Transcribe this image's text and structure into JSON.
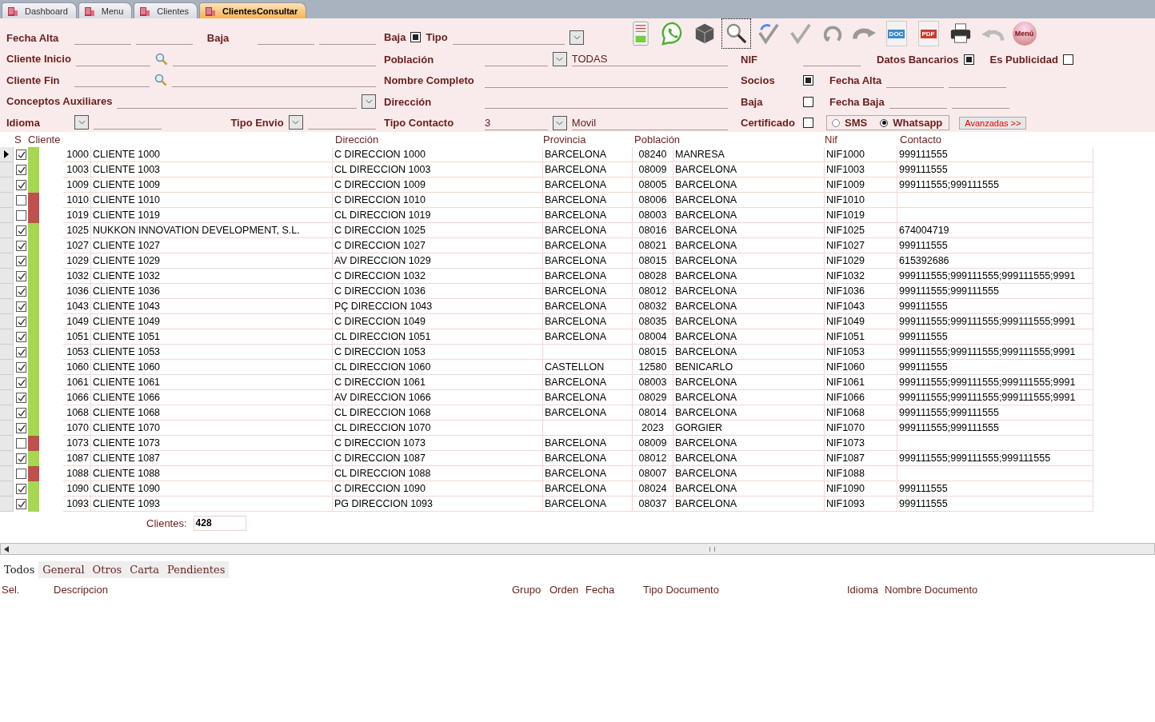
{
  "tabs": [
    {
      "label": "Dashboard",
      "selected": false
    },
    {
      "label": "Menu",
      "selected": false
    },
    {
      "label": "Clientes",
      "selected": false
    },
    {
      "label": "ClientesConsultar",
      "selected": true
    }
  ],
  "filters": {
    "left": [
      [
        {
          "kind": "label",
          "text": "Fecha Alta"
        },
        {
          "kind": "field"
        },
        {
          "kind": "field"
        },
        {
          "kind": "label",
          "text": "Baja"
        },
        {
          "kind": "field"
        },
        {
          "kind": "field"
        }
      ],
      [
        {
          "kind": "label",
          "text": "Cliente Inicio"
        },
        {
          "kind": "field"
        },
        {
          "kind": "search"
        },
        {
          "kind": "longfield"
        }
      ],
      [
        {
          "kind": "label",
          "text": "Cliente Fin"
        },
        {
          "kind": "field"
        },
        {
          "kind": "search"
        },
        {
          "kind": "longfield"
        }
      ],
      [
        {
          "kind": "label",
          "text": "Conceptos Auxiliares"
        },
        {
          "kind": "longfield"
        },
        {
          "kind": "dropdown"
        }
      ],
      [
        {
          "kind": "label",
          "text": "Idioma"
        },
        {
          "kind": "dropdown"
        },
        {
          "kind": "field"
        },
        {
          "kind": "label",
          "text": "Tipo Envio"
        },
        {
          "kind": "dropdown"
        },
        {
          "kind": "field"
        }
      ]
    ],
    "top": [
      {
        "kind": "label",
        "text": "Baja"
      },
      {
        "kind": "checkbox",
        "checked": true
      },
      {
        "kind": "label",
        "text": "Tipo"
      },
      {
        "kind": "longfield"
      },
      {
        "kind": "dropdown"
      }
    ],
    "middle": [
      [
        {
          "kind": "label",
          "text": "Población"
        },
        {
          "kind": "field"
        },
        {
          "kind": "dropdown"
        },
        {
          "kind": "longfield",
          "value": "TODAS"
        }
      ],
      [
        {
          "kind": "label",
          "text": "Nombre Completo"
        },
        {
          "kind": "longfield"
        }
      ],
      [
        {
          "kind": "label",
          "text": "Dirección"
        },
        {
          "kind": "longfield"
        }
      ],
      [
        {
          "kind": "label",
          "text": "Tipo Contacto"
        },
        {
          "kind": "field",
          "value": "3"
        },
        {
          "kind": "dropdown"
        },
        {
          "kind": "longfield",
          "value": "Movil"
        }
      ]
    ],
    "right": [
      [
        {
          "kind": "label",
          "text": "NIF"
        },
        {
          "kind": "field"
        },
        {
          "kind": "label",
          "text": "Datos Bancarios"
        },
        {
          "kind": "checkbox",
          "checked": true
        },
        {
          "kind": "label",
          "text": "Es Publicidad"
        },
        {
          "kind": "checkbox",
          "checked": false
        }
      ],
      [
        {
          "kind": "label",
          "text": "Socios"
        },
        {
          "kind": "checkbox",
          "checked": true
        },
        {
          "kind": "label",
          "text": "Fecha Alta"
        },
        {
          "kind": "field"
        },
        {
          "kind": "field"
        }
      ],
      [
        {
          "kind": "label",
          "text": "Baja"
        },
        {
          "kind": "checkbox",
          "checked": false
        },
        {
          "kind": "label",
          "text": "Fecha Baja"
        },
        {
          "kind": "field"
        },
        {
          "kind": "field"
        }
      ],
      [
        {
          "kind": "label",
          "text": "Certificado"
        },
        {
          "kind": "checkbox",
          "checked": false
        },
        {
          "kind": "radios",
          "options": [
            {
              "label": "SMS",
              "selected": false
            },
            {
              "label": "Whatsapp",
              "selected": true
            }
          ]
        },
        {
          "kind": "button",
          "label": "Avanzadas >>"
        }
      ]
    ]
  },
  "toolbar": [
    {
      "kind": "document",
      "focused": false
    },
    {
      "kind": "chat",
      "focused": false
    },
    {
      "kind": "cube",
      "focused": false
    },
    {
      "kind": "search",
      "focused": true
    },
    {
      "kind": "check-refresh",
      "focused": false
    },
    {
      "kind": "check",
      "focused": false
    },
    {
      "kind": "refresh",
      "focused": false
    },
    {
      "kind": "redo",
      "focused": false
    },
    {
      "kind": "doc",
      "label": "DOC",
      "focused": false
    },
    {
      "kind": "pdf",
      "label": "PDF",
      "focused": false
    },
    {
      "kind": "print",
      "focused": false
    },
    {
      "kind": "undo",
      "focused": false
    },
    {
      "kind": "menu",
      "label": "Menú",
      "focused": false
    }
  ],
  "table": {
    "columns": [
      "S",
      "Cliente",
      "Dirección",
      "Provincia",
      "Población",
      "Nif",
      "Contacto"
    ],
    "rows": [
      {
        "current": true,
        "checked": true,
        "color": "#a5d74f",
        "code": "1000",
        "name": "CLIENTE 1000",
        "address": "C DIRECCION 1000",
        "province": "BARCELONA",
        "zip": "08240",
        "town": "MANRESA",
        "nif": "NIF1000",
        "contact": "999111555"
      },
      {
        "current": false,
        "checked": true,
        "color": "#a5d74f",
        "code": "1003",
        "name": "CLIENTE 1003",
        "address": "CL DIRECCION 1003",
        "province": "BARCELONA",
        "zip": "08009",
        "town": "BARCELONA",
        "nif": "NIF1003",
        "contact": "999111555"
      },
      {
        "current": false,
        "checked": true,
        "color": "#a5d74f",
        "code": "1009",
        "name": "CLIENTE 1009",
        "address": "C DIRECCION 1009",
        "province": "BARCELONA",
        "zip": "08005",
        "town": "BARCELONA",
        "nif": "NIF1009",
        "contact": "999111555;999111555"
      },
      {
        "current": false,
        "checked": false,
        "color": "#c0504d",
        "code": "1010",
        "name": "CLIENTE 1010",
        "address": "C DIRECCION 1010",
        "province": "BARCELONA",
        "zip": "08006",
        "town": "BARCELONA",
        "nif": "NIF1010"
      },
      {
        "current": false,
        "checked": false,
        "color": "#c0504d",
        "code": "1019",
        "name": "CLIENTE 1019",
        "address": "CL DIRECCION 1019",
        "province": "BARCELONA",
        "zip": "08003",
        "town": "BARCELONA",
        "nif": "NIF1019"
      },
      {
        "current": false,
        "checked": true,
        "color": "#a5d74f",
        "code": "1025",
        "name": "NUKKON INNOVATION DEVELOPMENT, S.L.",
        "address": "C DIRECCION 1025",
        "province": "BARCELONA",
        "zip": "08016",
        "town": "BARCELONA",
        "nif": "NIF1025",
        "contact": "674004719"
      },
      {
        "current": false,
        "checked": true,
        "color": "#a5d74f",
        "code": "1027",
        "name": "CLIENTE 1027",
        "address": "C DIRECCION 1027",
        "province": "BARCELONA",
        "zip": "08021",
        "town": "BARCELONA",
        "nif": "NIF1027",
        "contact": "999111555"
      },
      {
        "current": false,
        "checked": true,
        "color": "#a5d74f",
        "code": "1029",
        "name": "CLIENTE 1029",
        "address": "AV DIRECCION 1029",
        "province": "BARCELONA",
        "zip": "08015",
        "town": "BARCELONA",
        "nif": "NIF1029",
        "contact": "615392686"
      },
      {
        "current": false,
        "checked": true,
        "color": "#a5d74f",
        "code": "1032",
        "name": "CLIENTE 1032",
        "address": "C DIRECCION 1032",
        "province": "BARCELONA",
        "zip": "08028",
        "town": "BARCELONA",
        "nif": "NIF1032",
        "contact": "999111555;999111555;999111555;9991"
      },
      {
        "current": false,
        "checked": true,
        "color": "#a5d74f",
        "code": "1036",
        "name": "CLIENTE 1036",
        "address": "C DIRECCION 1036",
        "province": "BARCELONA",
        "zip": "08012",
        "town": "BARCELONA",
        "nif": "NIF1036",
        "contact": "999111555;999111555"
      },
      {
        "current": false,
        "checked": true,
        "color": "#a5d74f",
        "code": "1043",
        "name": "CLIENTE 1043",
        "address": "PÇ DIRECCION 1043",
        "province": "BARCELONA",
        "zip": "08032",
        "town": "BARCELONA",
        "nif": "NIF1043",
        "contact": "999111555"
      },
      {
        "current": false,
        "checked": true,
        "color": "#a5d74f",
        "code": "1049",
        "name": "CLIENTE 1049",
        "address": "C DIRECCION 1049",
        "province": "BARCELONA",
        "zip": "08035",
        "town": "BARCELONA",
        "nif": "NIF1049",
        "contact": "999111555;999111555;999111555;9991"
      },
      {
        "current": false,
        "checked": true,
        "color": "#a5d74f",
        "code": "1051",
        "name": "CLIENTE 1051",
        "address": "CL DIRECCION 1051",
        "province": "BARCELONA",
        "zip": "08004",
        "town": "BARCELONA",
        "nif": "NIF1051",
        "contact": "999111555"
      },
      {
        "current": false,
        "checked": true,
        "color": "#a5d74f",
        "code": "1053",
        "name": "CLIENTE 1053",
        "address": "C DIRECCION 1053",
        "zip": "08015",
        "town": "BARCELONA",
        "nif": "NIF1053",
        "contact": "999111555;999111555;999111555;9991"
      },
      {
        "current": false,
        "checked": true,
        "color": "#a5d74f",
        "code": "1060",
        "name": "CLIENTE 1060",
        "address": "CL DIRECCION 1060",
        "province": "CASTELLON",
        "zip": "12580",
        "town": "BENICARLO",
        "nif": "NIF1060",
        "contact": "999111555"
      },
      {
        "current": false,
        "checked": true,
        "color": "#a5d74f",
        "code": "1061",
        "name": "CLIENTE 1061",
        "address": "C DIRECCION 1061",
        "province": "BARCELONA",
        "zip": "08003",
        "town": "BARCELONA",
        "nif": "NIF1061",
        "contact": "999111555;999111555;999111555;9991"
      },
      {
        "current": false,
        "checked": true,
        "color": "#a5d74f",
        "code": "1066",
        "name": "CLIENTE 1066",
        "address": "AV DIRECCION 1066",
        "province": "BARCELONA",
        "zip": "08029",
        "town": "BARCELONA",
        "nif": "NIF1066",
        "contact": "999111555;999111555;999111555;9991"
      },
      {
        "current": false,
        "checked": true,
        "color": "#a5d74f",
        "code": "1068",
        "name": "CLIENTE 1068",
        "address": "CL DIRECCION 1068",
        "province": "BARCELONA",
        "zip": "08014",
        "town": "BARCELONA",
        "nif": "NIF1068",
        "contact": "999111555;999111555"
      },
      {
        "current": false,
        "checked": true,
        "color": "#a5d74f",
        "code": "1070",
        "name": "CLIENTE 1070",
        "address": "CL DIRECCION 1070",
        "zip": "2023",
        "town": "GORGIER",
        "nif": "NIF1070",
        "contact": "999111555;999111555"
      },
      {
        "current": false,
        "checked": false,
        "color": "#c0504d",
        "code": "1073",
        "name": "CLIENTE 1073",
        "address": "C DIRECCION 1073",
        "province": "BARCELONA",
        "zip": "08009",
        "town": "BARCELONA",
        "nif": "NIF1073"
      },
      {
        "current": false,
        "checked": true,
        "color": "#a5d74f",
        "code": "1087",
        "name": "CLIENTE 1087",
        "address": "C DIRECCION 1087",
        "province": "BARCELONA",
        "zip": "08012",
        "town": "BARCELONA",
        "nif": "NIF1087",
        "contact": "999111555;999111555;999111555"
      },
      {
        "current": false,
        "checked": false,
        "color": "#c0504d",
        "code": "1088",
        "name": "CLIENTE 1088",
        "address": "CL DIRECCION 1088",
        "province": "BARCELONA",
        "zip": "08007",
        "town": "BARCELONA",
        "nif": "NIF1088"
      },
      {
        "current": false,
        "checked": true,
        "color": "#a5d74f",
        "code": "1090",
        "name": "CLIENTE 1090",
        "address": "C DIRECCION 1090",
        "province": "BARCELONA",
        "zip": "08024",
        "town": "BARCELONA",
        "nif": "NIF1090",
        "contact": "999111555"
      },
      {
        "current": false,
        "checked": true,
        "color": "#a5d74f",
        "code": "1093",
        "name": "CLIENTE 1093",
        "address": "PG DIRECCION 1093",
        "province": "BARCELONA",
        "zip": "08037",
        "town": "BARCELONA",
        "nif": "NIF1093",
        "contact": "999111555"
      }
    ]
  },
  "count": {
    "label": "Clientes:",
    "value": "428"
  },
  "doc_tabs": [
    {
      "label": "Todos",
      "selected": true
    },
    {
      "label": "General",
      "selected": false
    },
    {
      "label": "Otros",
      "selected": false
    },
    {
      "label": "Carta",
      "selected": false
    },
    {
      "label": "Pendientes",
      "selected": false
    }
  ],
  "doc_columns": [
    "Sel.",
    "Descripcion",
    "Grupo",
    "Orden",
    "Fecha",
    "Tipo Documento",
    "Idioma",
    "Nombre Documento"
  ]
}
